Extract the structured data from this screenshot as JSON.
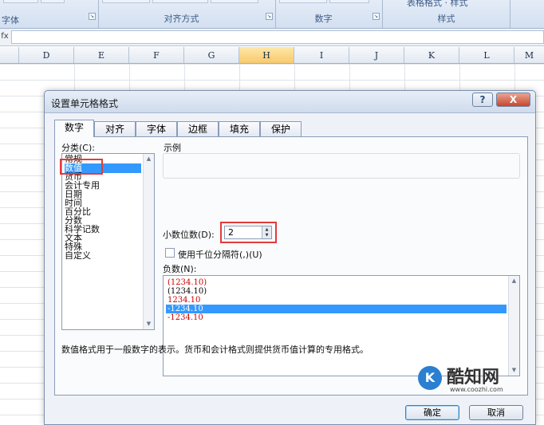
{
  "ribbon": {
    "left_text": "字体",
    "groups": [
      {
        "name": "对齐方式"
      },
      {
        "name": "数字"
      },
      {
        "name": "样式",
        "top_text": "表格格式 · 样式"
      }
    ]
  },
  "formula_bar": {
    "fx": "fx",
    "value": ""
  },
  "columns": [
    "D",
    "E",
    "F",
    "G",
    "H",
    "I",
    "J",
    "K",
    "L",
    "M"
  ],
  "active_column": "H",
  "dialog": {
    "title": "设置单元格格式",
    "help_label": "?",
    "close_label": "X",
    "tabs": [
      "数字",
      "对齐",
      "字体",
      "边框",
      "填充",
      "保护"
    ],
    "active_tab": "数字",
    "category_label": "分类(C):",
    "categories": [
      "常规",
      "数值",
      "货币",
      "会计专用",
      "日期",
      "时间",
      "百分比",
      "分数",
      "科学记数",
      "文本",
      "特殊",
      "自定义"
    ],
    "selected_category": "数值",
    "sample_label": "示例",
    "sample_value": "",
    "decimals_label": "小数位数(D):",
    "decimals_value": "2",
    "thousands_label": "使用千位分隔符(,)(U)",
    "thousands_checked": false,
    "negative_label": "负数(N):",
    "negative_formats": [
      {
        "text": "(1234.10)",
        "color": "#cc0000"
      },
      {
        "text": "(1234.10)",
        "color": "#000000"
      },
      {
        "text": "1234.10",
        "color": "#cc0000"
      },
      {
        "text": "-1234.10",
        "color": "#ffffff"
      },
      {
        "text": "-1234.10",
        "color": "#cc0000"
      }
    ],
    "selected_negative": 3,
    "description": "数值格式用于一般数字的表示。货币和会计格式则提供货币值计算的专用格式。",
    "ok_label": "确定",
    "cancel_label": "取消"
  },
  "watermark": {
    "name": "酷知网",
    "url": "www.coozhi.com"
  },
  "colors": {
    "selection": "#3399ff",
    "highlight_box": "#e23b3b"
  }
}
